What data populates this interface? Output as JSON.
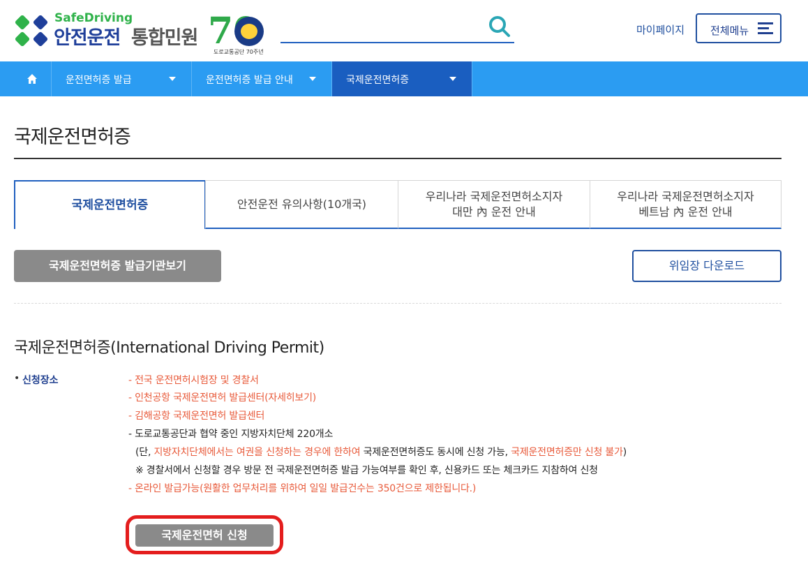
{
  "header": {
    "logo_en": "SafeDriving",
    "logo_ko": "안전운전",
    "logo_sub": "통합민원",
    "anniversary_number": "70",
    "anniversary_caption": "도로교통공단 70주년",
    "mypage_label": "마이페이지",
    "menu_label": "전체메뉴",
    "icons": {
      "search": "search-icon",
      "menu": "hamburger-icon",
      "home": "home-icon"
    }
  },
  "nav": {
    "items": [
      {
        "label": "운전면허증 발급"
      },
      {
        "label": "운전면허증 발급 안내"
      },
      {
        "label": "국제운전면허증"
      }
    ],
    "active_index": 2
  },
  "page": {
    "title": "국제운전면허증",
    "tabs": [
      {
        "label": "국제운전면허증"
      },
      {
        "label": "안전운전 유의사항(10개국)"
      },
      {
        "line1": "우리나라 국제운전면허소지자",
        "line2": "대만 內 운전 안내"
      },
      {
        "line1": "우리나라 국제운전면허소지자",
        "line2": "베트남 內 운전 안내"
      }
    ],
    "issuer_button": "국제운전면허증 발급기관보기",
    "download_button": "위임장 다운로드",
    "section_title": "국제운전면허증(International Driving Permit)",
    "field_label": "신청장소",
    "place_lines": {
      "l1": "- 전국 운전면허시험장 및 경찰서",
      "l2": "- 인천공항 국제운전면허 발급센터(자세히보기)",
      "l3": "- 김해공항 국제운전면허 발급센터",
      "l4": "- 도로교통공단과 협약 중인 지방자치단체 220개소",
      "l5_a": "(단, ",
      "l5_b": "지방자치단체에서는 여권을 신청하는 경우에 한하여",
      "l5_c": " 국제운전면허증도 동시에 신청 가능, ",
      "l5_d": "국제운전면허증만 신청 불가",
      "l5_e": ")",
      "l6": "※ 경찰서에서 신청할 경우 방문 전 국제운전면허증 발급 가능여부를 확인 후, 신용카드 또는 체크카드 지참하여 신청",
      "l7": "- 온라인 발급가능(원활한 업무처리를 위하여 일일 발급건수는 350건으로 제한됩니다.)"
    },
    "apply_button": "국제운전면허 신청"
  },
  "colors": {
    "nav_bg": "#2b9cf2",
    "nav_active": "#1a5ec0",
    "brand_blue": "#1f4f9f",
    "brand_green": "#2fb24a",
    "highlight_red": "#e85a3a",
    "focus_ring": "#e41d1d"
  }
}
